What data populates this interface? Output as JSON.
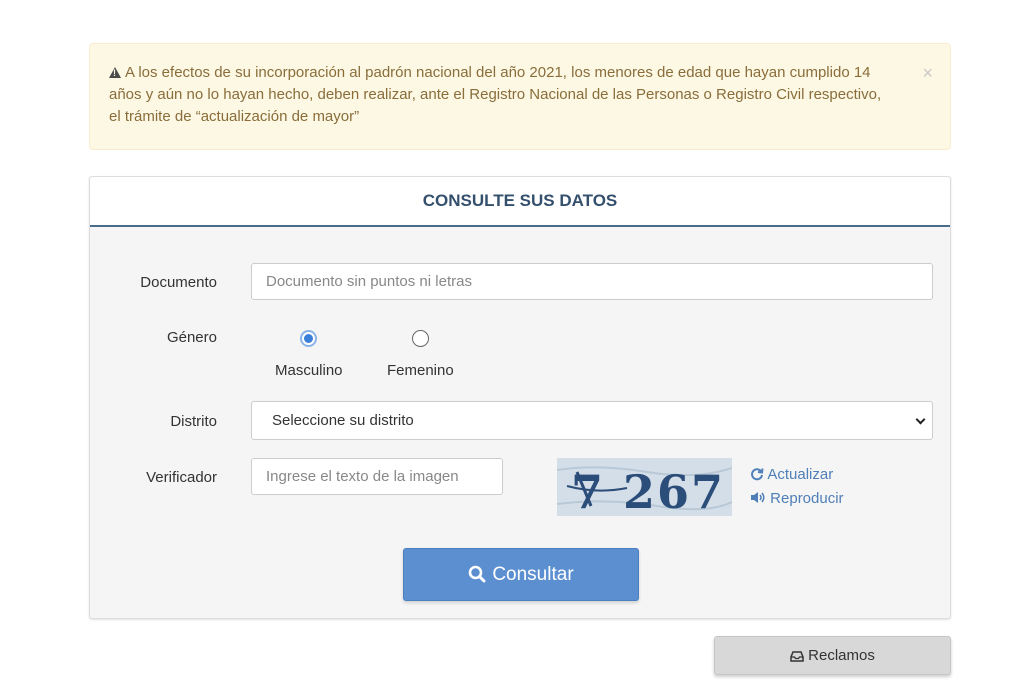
{
  "alert": {
    "icon": "warning-icon",
    "text": "A los efectos de su incorporación al padrón nacional del año 2021, los menores de edad que hayan cumplido 14 años y aún no lo hayan hecho, deben realizar, ante el Registro Nacional de las Personas o Registro Civil respectivo, el trámite de “actualización de mayor”",
    "close": "×"
  },
  "panel": {
    "title": "CONSULTE SUS DATOS"
  },
  "form": {
    "documento": {
      "label": "Documento",
      "placeholder": "Documento sin puntos ni letras",
      "value": ""
    },
    "genero": {
      "label": "Género",
      "options": [
        {
          "label": "Masculino",
          "selected": true
        },
        {
          "label": "Femenino",
          "selected": false
        }
      ]
    },
    "distrito": {
      "label": "Distrito",
      "selected": "Seleccione su distrito"
    },
    "verificador": {
      "label": "Verificador",
      "placeholder": "Ingrese el texto de la imagen",
      "value": "",
      "captcha_text": "7 267",
      "refresh_label": "Actualizar",
      "audio_label": "Reproducir"
    },
    "submit_label": "Consultar"
  },
  "reclamos_label": "Reclamos",
  "colors": {
    "alert_bg": "#fcf8e3",
    "alert_text": "#8a6d3b",
    "heading_text": "#34506d",
    "primary_button": "#5b8fd0",
    "link": "#4f7fb8"
  }
}
